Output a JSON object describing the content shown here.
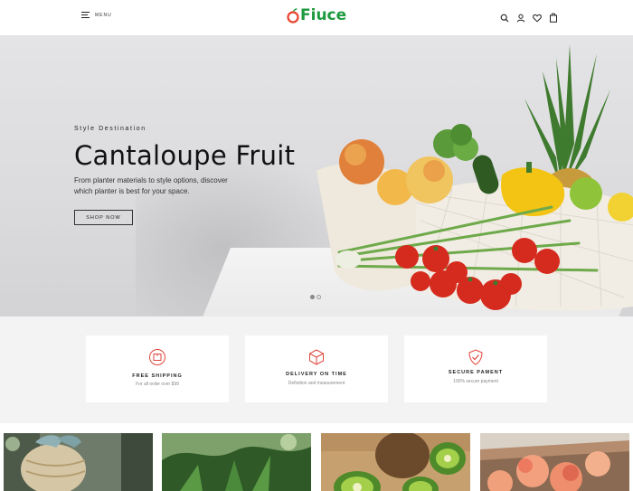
{
  "header": {
    "menu_label": "MENU",
    "logo_text": "Fiuce",
    "icons": [
      "search-icon",
      "user-icon",
      "heart-icon",
      "bag-icon"
    ]
  },
  "hero": {
    "kicker": "Style Destination",
    "title": "Cantaloupe Fruit",
    "description": "From planter materials to style options, discover which planter is best for your space.",
    "button_label": "SHOP NOW",
    "slides": 2,
    "active_slide": 1
  },
  "features": [
    {
      "icon": "shipping-box-icon",
      "title": "FREE SHIPPING",
      "subtitle": "For all order over $99"
    },
    {
      "icon": "package-icon",
      "title": "DELIVERY ON TIME",
      "subtitle": "Definition and measurement"
    },
    {
      "icon": "shield-check-icon",
      "title": "SECURE PAMENT",
      "subtitle": "100% secure payment"
    }
  ],
  "colors": {
    "brand_green": "#1f9a3f",
    "brand_red": "#e8412c",
    "feature_icon": "#e0463c"
  }
}
